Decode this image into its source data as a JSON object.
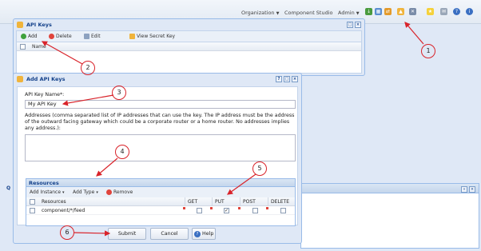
{
  "topbar": {
    "organization": "Organization",
    "component_studio": "Component Studio",
    "admin": "Admin"
  },
  "api_keys_window": {
    "title": "API Keys",
    "toolbar": {
      "add": "Add",
      "delete": "Delete",
      "edit": "Edit",
      "view_secret_key": "View Secret Key"
    },
    "columns": [
      "Name"
    ]
  },
  "dialog": {
    "title": "Add API Keys",
    "api_key_name_label": "API Key Name*:",
    "api_key_name_value": "My API Key",
    "addresses_label": "Addresses (comma separated list of IP addresses that can use the key. The IP address must be the address of the outward facing gateway which could be a corporate router or a home router. No addresses implies any address.):",
    "resources": {
      "title": "Resources",
      "add_instance": "Add Instance",
      "add_type": "Add Type",
      "remove": "Remove",
      "columns": [
        "Resources",
        "GET",
        "PUT",
        "POST",
        "DELETE"
      ],
      "rows": [
        {
          "resource": "component/*/feed",
          "get": false,
          "put": true,
          "post": false,
          "delete": false
        }
      ]
    },
    "buttons": {
      "submit": "Submit",
      "cancel": "Cancel",
      "help": "Help"
    }
  },
  "side_label": "Q",
  "annotations": [
    "1",
    "2",
    "3",
    "4",
    "5",
    "6"
  ],
  "colors": {
    "annotation": "#d9232a",
    "header_text": "#15428b",
    "panel_border": "#99bbe8"
  }
}
